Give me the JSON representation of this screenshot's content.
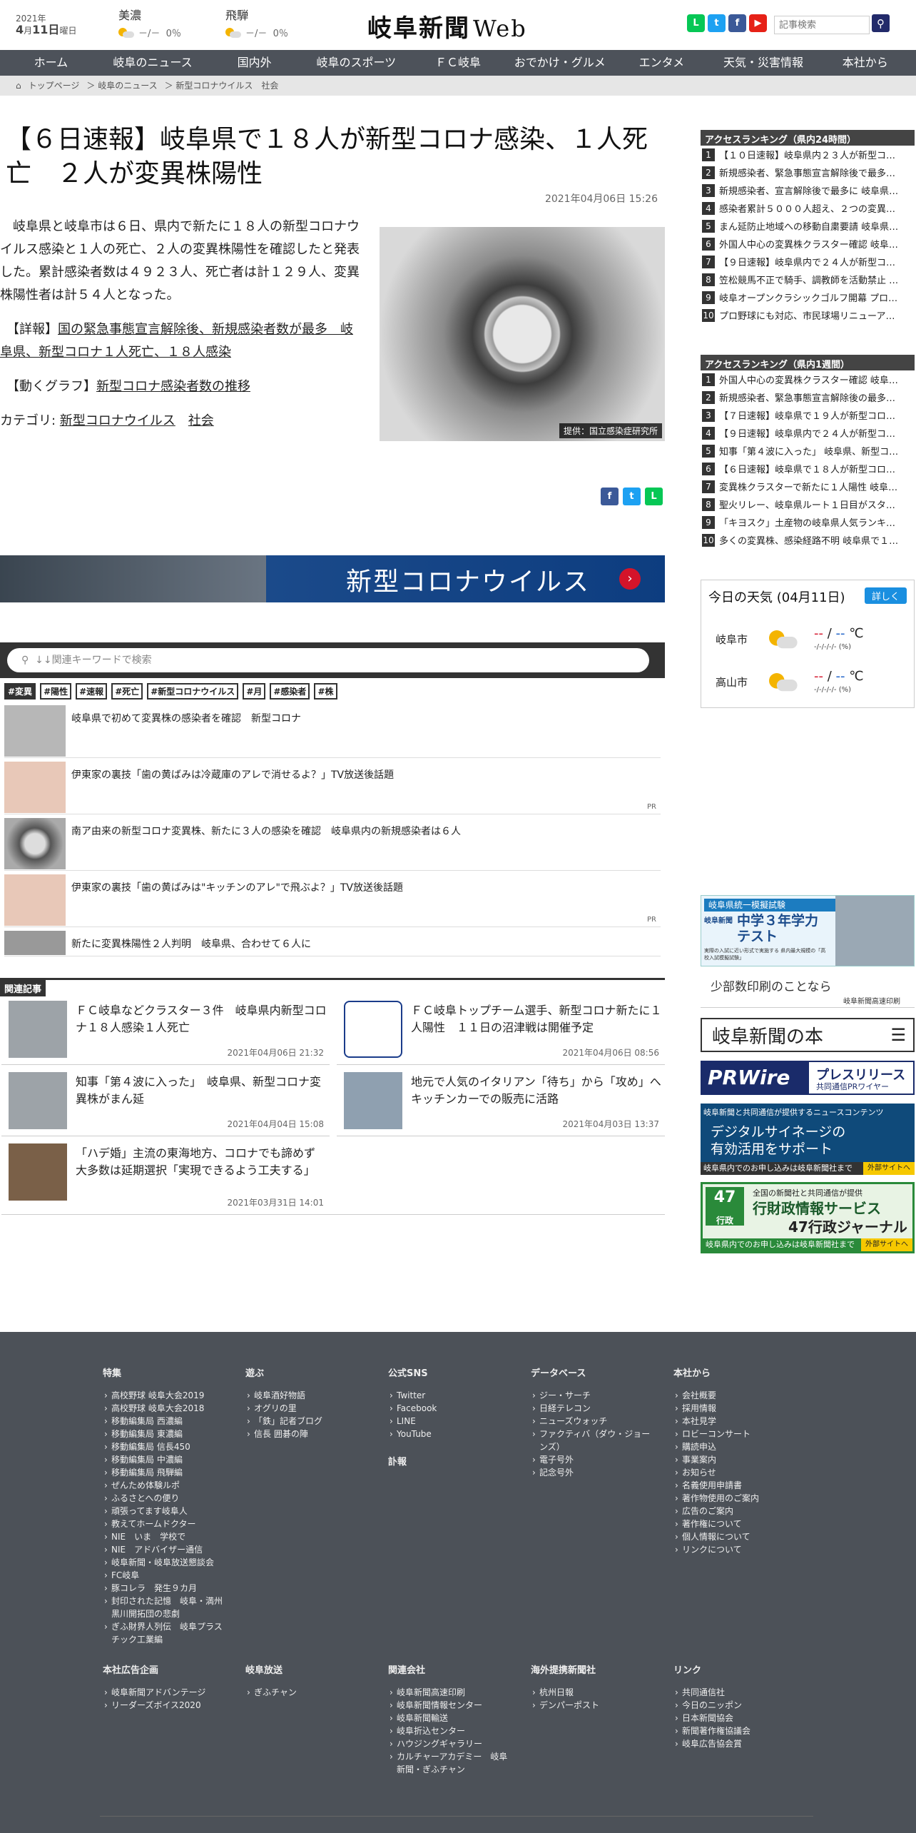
{
  "header": {
    "year": "2021年",
    "month": "4",
    "month_unit": "月",
    "day": "11",
    "day_unit": "日",
    "weekday": "曜日",
    "weather": [
      {
        "area": "美濃",
        "temp": "－/－",
        "rain": "0％"
      },
      {
        "area": "飛騨",
        "temp": "－/－",
        "rain": "0％"
      }
    ],
    "logo": "岐阜新聞",
    "logo_web": "Web",
    "search_placeholder": "記事検索",
    "sns": [
      {
        "name": "line",
        "label": "L",
        "color": "#06c755"
      },
      {
        "name": "twitter",
        "label": "t",
        "color": "#1da1f2"
      },
      {
        "name": "facebook",
        "label": "f",
        "color": "#3b5998"
      },
      {
        "name": "youtube",
        "label": "▶",
        "color": "#e62117"
      }
    ]
  },
  "nav": [
    "ホーム",
    "岐阜のニュース",
    "国内外",
    "岐阜のスポーツ",
    "ＦＣ岐阜",
    "おでかけ・グルメ",
    "エンタメ",
    "天気・災害情報",
    "本社から"
  ],
  "breadcrumb": [
    "トップページ",
    "＞ 岐阜のニュース",
    "＞ 新型コロナウイルス　社会"
  ],
  "article": {
    "title": "【６日速報】岐阜県で１８人が新型コロナ感染、１人死亡　２人が変異株陽性",
    "date": "2021年04月06日 15:26",
    "p1": "　岐阜県と岐阜市は６日、県内で新たに１８人の新型コロナウイルス感染と１人の死亡、２人の変異株陽性を確認したと発表した。累計感染者数は４９２３人、死亡者は計１２９人、変異株陽性者は計５４人となった。",
    "p2_prefix": "　【詳報】",
    "p2_link": "国の緊急事態宣言解除後、新規感染者数が最多　岐阜県、新型コロナ１人死亡、１８人感染",
    "p3_prefix": "　【動くグラフ】",
    "p3_link": "新型コロナ感染者数の推移",
    "cat_label": "カテゴリ: ",
    "cat1": "新型コロナウイルス",
    "cat2": "社会",
    "photo_caption": "提供：国立感染症研究所"
  },
  "banner": "新型コロナウイルス",
  "keyword_placeholder": "↓↓関連キーワードで検索",
  "tags": [
    "#変異",
    "#陽性",
    "#速報",
    "#死亡",
    "#新型コロナウイルス",
    "#月",
    "#感染者",
    "#株"
  ],
  "related_list": [
    {
      "text": "岐阜県で初めて変異株の感染者を確認　新型コロナ",
      "pr": ""
    },
    {
      "text": "伊東家の裏技「歯の黄ばみは冷蔵庫のアレで消せるよ？」TV放送後話題",
      "pr": "PR"
    },
    {
      "text": "南ア由来の新型コロナ変異株、新たに３人の感染を確認　岐阜県内の新規感染者は６人",
      "pr": ""
    },
    {
      "text": "伊東家の裏技「歯の黄ばみは\"キッチンのアレ\"で飛ぶよ？」TV放送後話題",
      "pr": "PR"
    },
    {
      "text": "新たに変異株陽性２人判明　岐阜県、合わせて６人に",
      "pr": ""
    }
  ],
  "related_header": "関連記事",
  "related_articles": [
    {
      "text": "ＦＣ岐阜などクラスター３件　岐阜県内新型コロナ１８人感染１人死亡",
      "date": "2021年04月06日 21:32"
    },
    {
      "text": "ＦＣ岐阜トップチーム選手、新型コロナ新たに１人陽性　１１日の沼津戦は開催予定",
      "date": "2021年04月06日 08:56"
    },
    {
      "text": "知事「第４波に入った」　岐阜県、新型コロナ変異株がまん延",
      "date": "2021年04月04日 15:08"
    },
    {
      "text": "地元で人気のイタリアン「待ち」から「攻め」へ　キッチンカーでの販売に活路",
      "date": "2021年04月03日 13:37"
    },
    {
      "text": "「ハデ婚」主流の東海地方、コロナでも諦めず　大多数は延期選択「実現できるよう工夫する」",
      "date": "2021年03月31日 14:01"
    }
  ],
  "rank24": {
    "title": "アクセスランキング（県内24時間）",
    "items": [
      "【１０日速報】岐阜県内２３人が新型コ…",
      "新規感染者、緊急事態宣言解除後で最多…",
      "新規感染者、宣言解除後で最多に 岐阜県…",
      "感染者累計５０００人超え、２つの変異…",
      "まん延防止地域への移動自粛要請 岐阜県…",
      "外国人中心の変異株クラスター確認 岐阜…",
      "【９日速報】岐阜県内で２４人が新型コ…",
      "笠松競馬不正で騎手、調教師を活動禁止 …",
      "岐阜オープンクラシックゴルフ開幕 プロ…",
      "プロ野球にも対応、市民球場リニューア…"
    ]
  },
  "rank1w": {
    "title": "アクセスランキング（県内1週間）",
    "items": [
      "外国人中心の変異株クラスター確認 岐阜…",
      "新規感染者、緊急事態宣言解除後の最多…",
      "【７日速報】岐阜県で１９人が新型コロ…",
      "【９日速報】岐阜県内で２４人が新型コ…",
      "知事「第４波に入った」 岐阜県、新型コ…",
      "【６日速報】岐阜県で１８人が新型コロ…",
      "変異株クラスターで新たに１人陽性 岐阜…",
      "聖火リレー、岐阜県ルート１日目がスタ…",
      "「キヨスク」土産物の岐阜県人気ランキ…",
      "多くの変異株、感染経路不明 岐阜県で１…"
    ]
  },
  "weather_box": {
    "title": "今日の天気 (04月11日)",
    "detail": "詳しく",
    "rows": [
      {
        "city": "岐阜市",
        "hi": "--",
        "lo": "--",
        "unit": "℃",
        "rain": "-/-/-/-/- (%)"
      },
      {
        "city": "高山市",
        "hi": "--",
        "lo": "--",
        "unit": "℃",
        "rain": "-/-/-/-/- (%)"
      }
    ]
  },
  "ads": {
    "a1_top": "岐阜県統一模擬試験",
    "a1_brand": "岐阜新聞",
    "a1_main": "中学３年学力テスト",
    "a1_sub": "実際の入試に近い形式で実施する 県内最大規模の「高校入試模擬試験」",
    "a2_main": "少部数印刷のことなら",
    "a2_sub": "岐阜新聞高速印刷",
    "a3": "岐阜新聞の本",
    "a4_pr": "PRWire",
    "a4_main": "プレスリリース",
    "a4_sub": "共同通信PRワイヤー",
    "a5_top": "岐阜新聞と共同通信が提供するニュースコンテンツ",
    "a5_main": "デジタルサイネージの有効活用をサポート",
    "a5_foot": "岐阜県内でのお申し込みは岐阜新聞社まで",
    "a5_ext": "外部サイトへ",
    "a6_num": "47",
    "a6_small": "行政",
    "a6_top": "全国の新聞社と共同通信が提供",
    "a6_main": "行財政情報サービス",
    "a6_sub": "47行政ジャーナル",
    "a6_foot": "岐阜県内でのお申し込みは岐阜新聞社まで",
    "a6_ext": "外部サイトへ"
  },
  "footer": [
    {
      "h": "特集",
      "items": [
        "高校野球 岐阜大会2019",
        "高校野球 岐阜大会2018",
        "移動編集局 西濃編",
        "移動編集局 東濃編",
        "移動編集局 信長450",
        "移動編集局 中濃編",
        "移動編集局 飛騨編",
        "ぜんため体験ルポ",
        "ふるさとへの便り",
        "頑張ってます岐阜人",
        "教えてホームドクター",
        "NIE　いま　学校で",
        "NIE　アドバイザー通信",
        "岐阜新聞・岐阜放送懇談会",
        "FC岐阜",
        "豚コレラ　発生９カ月",
        "封印された記憶　岐阜・満州黒川開拓団の悲劇",
        "ぎふ財界人列伝　岐阜プラスチック工業編"
      ]
    },
    {
      "h": "遊ぶ",
      "items": [
        "岐阜酒好物語",
        "オグリの里",
        "「鉄」記者ブログ",
        "信長 囲碁の陣"
      ]
    },
    {
      "h": "公式SNS",
      "items": [
        "Twitter",
        "Facebook",
        "LINE",
        "YouTube"
      ],
      "h2": "訃報"
    },
    {
      "h": "データベース",
      "items": [
        "ジー・サーチ",
        "日経テレコン",
        "ニューズウォッチ",
        "ファクティバ（ダウ・ジョーンズ）",
        "電子号外",
        "記念号外"
      ]
    },
    {
      "h": "本社から",
      "items": [
        "会社概要",
        "採用情報",
        "本社見学",
        "ロビーコンサート",
        "購読申込",
        "事業案内",
        "お知らせ",
        "名義使用申請書",
        "著作物使用のご案内",
        "広告のご案内",
        "著作権について",
        "個人情報について",
        "リンクについて"
      ]
    },
    {
      "h": "本社広告企画",
      "items": [
        "岐阜新聞アドバンテージ",
        "リーダーズボイス2020"
      ]
    },
    {
      "h": "岐阜放送",
      "items": [
        "ぎふチャン"
      ]
    },
    {
      "h": "関連会社",
      "items": [
        "岐阜新聞高速印刷",
        "岐阜新聞情報センター",
        "岐阜新聞輸送",
        "岐阜折込センター",
        "ハウジングギャラリー",
        "カルチャーアカデミー　岐阜新聞・ぎふチャン"
      ]
    },
    {
      "h": "海外提携新聞社",
      "items": [
        "杭州日報",
        "デンパーポスト"
      ]
    },
    {
      "h": "リンク",
      "items": [
        "共同通信社",
        "今日のニッポン",
        "日本新聞協会",
        "新聞著作権協議会",
        "岐阜広告協会賞"
      ]
    }
  ]
}
